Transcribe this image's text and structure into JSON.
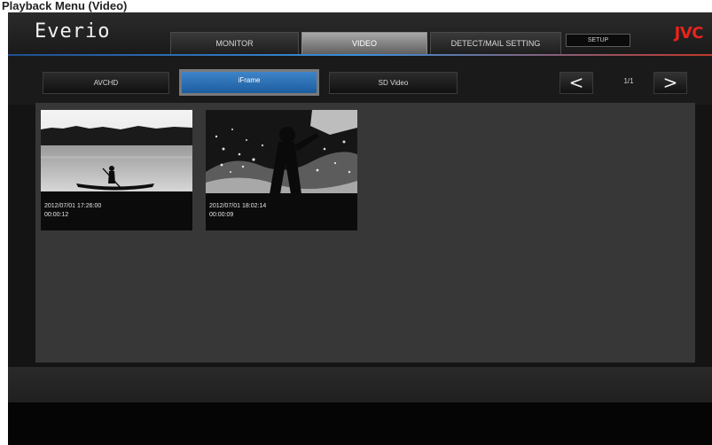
{
  "doc": {
    "caption": "Playback Menu (Video)"
  },
  "app": {
    "title": "Everio",
    "logo": "JVC",
    "accent_colors": [
      "#1f4e8f",
      "#3b8fd8",
      "#c0392b"
    ]
  },
  "top_tabs": [
    {
      "label": "MONITOR",
      "active": false
    },
    {
      "label": "VIDEO",
      "active": true
    },
    {
      "label": "DETECT/MAIL SETTING",
      "active": false
    }
  ],
  "settings_button": {
    "label": "SETUP"
  },
  "sub_tabs": [
    {
      "label": "AVCHD",
      "active": false
    },
    {
      "label": "iFrame",
      "active": true
    },
    {
      "label": "SD Video",
      "active": false
    }
  ],
  "pager": {
    "prev": "<",
    "indicator": "1/1",
    "next": ">"
  },
  "thumbnails": [
    {
      "date": "2012/07/01 17:26:00",
      "duration": "00:00:12"
    },
    {
      "date": "2012/07/01 18:02:14",
      "duration": "00:00:09"
    }
  ]
}
